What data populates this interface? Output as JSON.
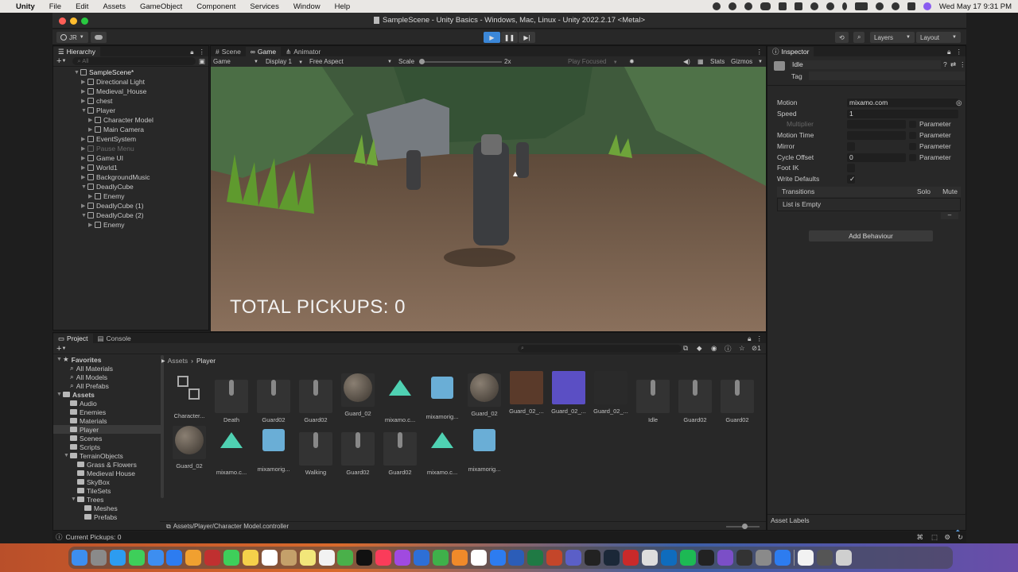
{
  "menubar": {
    "app": "Unity",
    "items": [
      "File",
      "Edit",
      "Assets",
      "GameObject",
      "Component",
      "Services",
      "Window",
      "Help"
    ],
    "datetime": "Wed May 17  9:31 PM"
  },
  "window_title": "SampleScene - Unity Basics - Windows, Mac, Linux - Unity 2022.2.17 <Metal>",
  "toolbar": {
    "account": "JR",
    "layers": "Layers",
    "layout": "Layout",
    "play_icon": "play-icon",
    "pause_icon": "pause-icon",
    "step_icon": "step-icon"
  },
  "hierarchy": {
    "tab": "Hierarchy",
    "search_placeholder": "All",
    "items": [
      {
        "label": "SampleScene*",
        "depth": 0
      },
      {
        "label": "Directional Light",
        "depth": 1
      },
      {
        "label": "Medieval_House",
        "depth": 1
      },
      {
        "label": "chest",
        "depth": 1
      },
      {
        "label": "Player",
        "depth": 1
      },
      {
        "label": "Character Model",
        "depth": 2
      },
      {
        "label": "Main Camera",
        "depth": 2
      },
      {
        "label": "EventSystem",
        "depth": 1
      },
      {
        "label": "Pause Menu",
        "depth": 1
      },
      {
        "label": "Game UI",
        "depth": 1
      },
      {
        "label": "World1",
        "depth": 1
      },
      {
        "label": "BackgroundMusic",
        "depth": 1
      },
      {
        "label": "DeadlyCube",
        "depth": 1
      },
      {
        "label": "Enemy",
        "depth": 2
      },
      {
        "label": "DeadlyCube (1)",
        "depth": 1
      },
      {
        "label": "DeadlyCube (2)",
        "depth": 1
      },
      {
        "label": "Enemy",
        "depth": 2
      }
    ]
  },
  "scene_tabs": [
    "Scene",
    "Game",
    "Animator"
  ],
  "game_bar": {
    "mode": "Game",
    "display": "Display 1",
    "aspect": "Free Aspect",
    "scale_label": "Scale",
    "scale_value": "2x",
    "play_focused": "Play Focused",
    "stats": "Stats",
    "gizmos": "Gizmos"
  },
  "game": {
    "pickups_text": "TOTAL PICKUPS: 0"
  },
  "inspector": {
    "tab": "Inspector",
    "state_name": "Idle",
    "tag_label": "Tag",
    "fields": [
      {
        "label": "Motion",
        "value": "mixamo.com"
      },
      {
        "label": "Speed",
        "value": "1"
      },
      {
        "label": "Multiplier",
        "value": "",
        "param": "Parameter"
      },
      {
        "label": "Motion Time",
        "value": "",
        "param": "Parameter"
      },
      {
        "label": "Mirror",
        "value": "",
        "param": "Parameter"
      },
      {
        "label": "Cycle Offset",
        "value": "0",
        "param": "Parameter"
      },
      {
        "label": "Foot IK",
        "value": ""
      },
      {
        "label": "Write Defaults",
        "value": "✓"
      }
    ],
    "transitions": "Transitions",
    "solo": "Solo",
    "mute": "Mute",
    "list_empty": "List is Empty",
    "add_behaviour": "Add Behaviour",
    "asset_labels": "Asset Labels"
  },
  "project": {
    "tabs": [
      "Project",
      "Console"
    ],
    "breadcrumb": [
      "Assets",
      "Player"
    ],
    "tree": [
      {
        "label": "Favorites",
        "depth": 0,
        "bold": true
      },
      {
        "label": "All Materials",
        "depth": 1
      },
      {
        "label": "All Models",
        "depth": 1
      },
      {
        "label": "All Prefabs",
        "depth": 1
      },
      {
        "label": "Assets",
        "depth": 0,
        "bold": true
      },
      {
        "label": "Audio",
        "depth": 1
      },
      {
        "label": "Enemies",
        "depth": 1
      },
      {
        "label": "Materials",
        "depth": 1
      },
      {
        "label": "Player",
        "depth": 1
      },
      {
        "label": "Scenes",
        "depth": 1
      },
      {
        "label": "Scripts",
        "depth": 1
      },
      {
        "label": "TerrainObjects",
        "depth": 1
      },
      {
        "label": "Grass & Flowers",
        "depth": 2
      },
      {
        "label": "Medieval House",
        "depth": 2
      },
      {
        "label": "SkyBox",
        "depth": 2
      },
      {
        "label": "TileSets",
        "depth": 2
      },
      {
        "label": "Trees",
        "depth": 2
      },
      {
        "label": "Meshes",
        "depth": 3
      },
      {
        "label": "Prefabs",
        "depth": 3
      }
    ],
    "assets_row1": [
      "Character...",
      "Death",
      "Guard02",
      "Guard02",
      "Guard_02",
      "mixamo.c...",
      "mixamorig...",
      "Guard_02",
      "Guard_02_...",
      "Guard_02_...",
      "Guard_02_...",
      "Idle",
      "Guard02",
      "Guard02"
    ],
    "assets_row2": [
      "Guard_02",
      "mixamo.c...",
      "mixamorig...",
      "Walking",
      "Guard02",
      "Guard02",
      "mixamo.c...",
      "mixamorig..."
    ],
    "footer_path": "Assets/Player/Character Model.controller",
    "hidden_count": "1"
  },
  "statusbar": {
    "text": "Current Pickups: 0"
  },
  "colors": {
    "accent": "#3b87d8",
    "panel": "#282828",
    "menubar": "#e9e7e4"
  }
}
